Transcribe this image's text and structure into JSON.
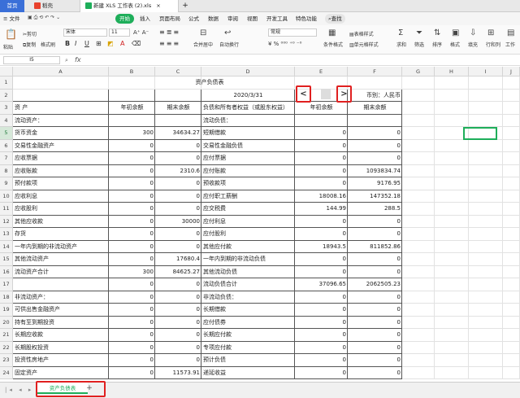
{
  "tabs": [
    {
      "label": "首页"
    },
    {
      "label": "稻壳"
    },
    {
      "label": "新建 XLS 工作表 (2).xls"
    }
  ],
  "menu": [
    {
      "label": "≡ 文件"
    },
    {
      "label": "开始"
    },
    {
      "label": "插入"
    },
    {
      "label": "页面布局"
    },
    {
      "label": "公式"
    },
    {
      "label": "数据"
    },
    {
      "label": "审阅"
    },
    {
      "label": "视图"
    },
    {
      "label": "开发工具"
    },
    {
      "label": "特色功能"
    },
    {
      "label": "查找"
    }
  ],
  "ribbon": {
    "paste": "粘贴",
    "cut": "剪切",
    "copy": "复制",
    "format_painter": "格式刷",
    "font_name": "宋体",
    "font_size": "11",
    "merge_center": "合并居中",
    "wrap_text": "自动换行",
    "number_format": "常规",
    "cond_format": "条件格式",
    "table_style": "表格样式",
    "cell_style": "单元格样式",
    "sum": "求和",
    "filter": "筛选",
    "sort": "排序",
    "format": "格式",
    "fill": "填充",
    "row_col": "行和列",
    "worksheet": "工作"
  },
  "formula_bar": {
    "cell_ref": "I5",
    "fx": "fx",
    "value": ""
  },
  "columns": [
    "A",
    "B",
    "C",
    "D",
    "E",
    "F",
    "G",
    "H",
    "I",
    "J"
  ],
  "rows": [
    {
      "n": "1",
      "a": "",
      "b": "",
      "c": "",
      "d": "",
      "e": "",
      "f": ""
    },
    {
      "n": "2",
      "a": "",
      "b": "",
      "c": "",
      "d": "2020/3/31",
      "e": "",
      "f": "币别：人民币"
    },
    {
      "n": "3",
      "a": "资        产",
      "b": "年初余额",
      "c": "期末余额",
      "d": "负债和所有者权益（或股东权益）",
      "e": "年初余额",
      "f": "期末余额"
    },
    {
      "n": "4",
      "a": "流动资产：",
      "b": "",
      "c": "",
      "d": "流动负债：",
      "e": "",
      "f": ""
    },
    {
      "n": "5",
      "a": "    货币资金",
      "b": "300",
      "c": "34634.27",
      "d": "    短期借款",
      "e": "0",
      "f": "0"
    },
    {
      "n": "6",
      "a": "    交易性金融资产",
      "b": "0",
      "c": "0",
      "d": "    交易性金融负债",
      "e": "0",
      "f": "0"
    },
    {
      "n": "7",
      "a": "    应收票据",
      "b": "0",
      "c": "0",
      "d": "    应付票据",
      "e": "0",
      "f": "0"
    },
    {
      "n": "8",
      "a": "    应收账款",
      "b": "0",
      "c": "2310.6",
      "d": "    应付账款",
      "e": "0",
      "f": "1093834.74"
    },
    {
      "n": "9",
      "a": "    预付款项",
      "b": "0",
      "c": "0",
      "d": "    预收款项",
      "e": "0",
      "f": "9176.95"
    },
    {
      "n": "10",
      "a": "    应收利息",
      "b": "0",
      "c": "0",
      "d": "    应付职工薪酬",
      "e": "18008.16",
      "f": "147352.18"
    },
    {
      "n": "11",
      "a": "    应收股利",
      "b": "0",
      "c": "0",
      "d": "    应交税费",
      "e": "144.99",
      "f": "288.5"
    },
    {
      "n": "12",
      "a": "    其他应收款",
      "b": "0",
      "c": "30000",
      "d": "    应付利息",
      "e": "0",
      "f": "0"
    },
    {
      "n": "13",
      "a": "    存货",
      "b": "0",
      "c": "0",
      "d": "    应付股利",
      "e": "0",
      "f": "0"
    },
    {
      "n": "14",
      "a": "    一年内到期的非流动资产",
      "b": "0",
      "c": "0",
      "d": "    其他应付款",
      "e": "18943.5",
      "f": "811852.86"
    },
    {
      "n": "15",
      "a": "    其他流动资产",
      "b": "0",
      "c": "17680.4",
      "d": "    一年内到期的非流动负债",
      "e": "0",
      "f": "0"
    },
    {
      "n": "16",
      "a": "    流动资产合计",
      "b": "300",
      "c": "84625.27",
      "d": "    其他流动负债",
      "e": "0",
      "f": "0"
    },
    {
      "n": "17",
      "a": "",
      "b": "0",
      "c": "0",
      "d": "流动负债合计",
      "e": "37096.65",
      "f": "2062505.23"
    },
    {
      "n": "18",
      "a": "非流动资产：",
      "b": "0",
      "c": "0",
      "d": "非流动负债：",
      "e": "0",
      "f": "0"
    },
    {
      "n": "19",
      "a": "    可供出售金融资产",
      "b": "0",
      "c": "0",
      "d": "    长期借款",
      "e": "0",
      "f": "0"
    },
    {
      "n": "20",
      "a": "    持有至到期投资",
      "b": "0",
      "c": "0",
      "d": "    应付债券",
      "e": "0",
      "f": "0"
    },
    {
      "n": "21",
      "a": "    长期应收款",
      "b": "0",
      "c": "0",
      "d": "    长期应付款",
      "e": "0",
      "f": "0"
    },
    {
      "n": "22",
      "a": "    长期股权投资",
      "b": "0",
      "c": "0",
      "d": "    专项应付款",
      "e": "0",
      "f": "0"
    },
    {
      "n": "23",
      "a": "    投资性房地产",
      "b": "0",
      "c": "0",
      "d": "    预计负债",
      "e": "0",
      "f": "0"
    },
    {
      "n": "24",
      "a": "    固定资产",
      "b": "0",
      "c": "11573.91",
      "d": "    递延收益",
      "e": "0",
      "f": "0"
    }
  ],
  "sheet_title": "资产负债表",
  "sheet_tab": "资产负债表",
  "nav": {
    "prev": "<",
    "next": ">"
  },
  "colors": {
    "accent": "#1eae5a",
    "highlight": "#e02020",
    "tab_blue": "#3a6fd8"
  }
}
